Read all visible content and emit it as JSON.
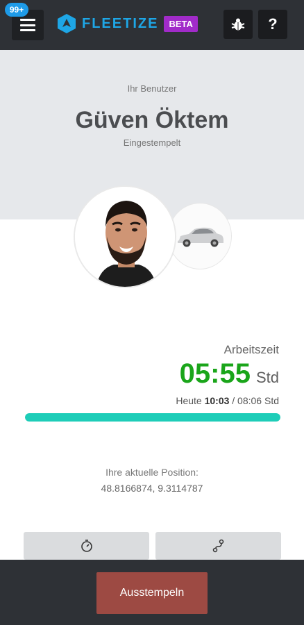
{
  "topbar": {
    "notification_count": "99+",
    "app_name": "FLEETIZE",
    "beta_label": "BETA",
    "menu_icon": "hamburger-menu-icon",
    "bug_icon": "bug-icon",
    "help_label": "?"
  },
  "user": {
    "caption": "Ihr Benutzer",
    "name": "Güven Öktem",
    "status": "Eingestempelt"
  },
  "worktime": {
    "label": "Arbeitszeit",
    "time": "05:55",
    "unit": "Std",
    "today_prefix": "Heute",
    "today_value": "10:03",
    "today_suffix": "/ 08:06 Std",
    "progress_fraction": 1.0
  },
  "position": {
    "label": "Ihre aktuelle Position:",
    "coords": "48.8166874, 9.3114787"
  },
  "actions": {
    "left_icon": "stopwatch-icon",
    "right_icon": "route-icon",
    "clock_out_label": "Ausstempeln"
  },
  "colors": {
    "topbar": "#2e3136",
    "brand": "#1ea6e6",
    "beta": "#a12bc9",
    "worktime": "#1aa51a",
    "progress": "#1ecdb8",
    "clock_out": "#9d4a43"
  }
}
